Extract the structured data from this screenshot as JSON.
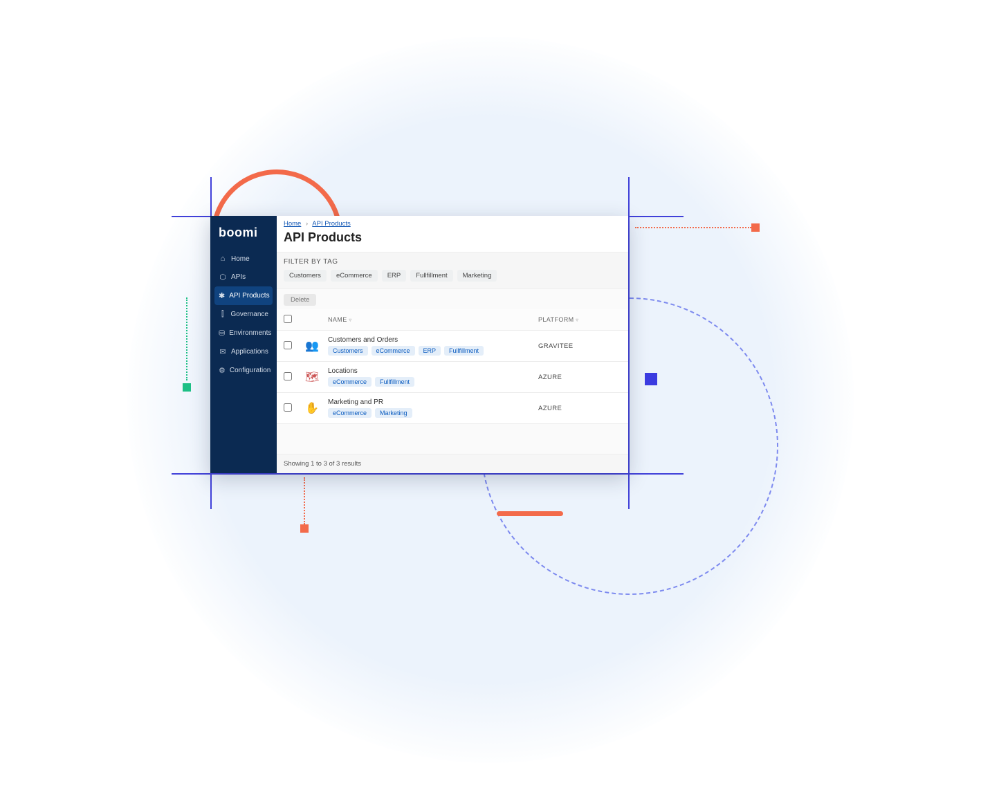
{
  "brand": "boomi",
  "sidebar": {
    "items": [
      {
        "icon": "⌂",
        "label": "Home"
      },
      {
        "icon": "⬡",
        "label": "APIs"
      },
      {
        "icon": "✱",
        "label": "API Products",
        "active": true
      },
      {
        "icon": "⫿",
        "label": "Governance"
      },
      {
        "icon": "⛁",
        "label": "Environments"
      },
      {
        "icon": "✉",
        "label": "Applications"
      },
      {
        "icon": "⚙",
        "label": "Configuration"
      }
    ]
  },
  "breadcrumbs": {
    "home": "Home",
    "current": "API Products"
  },
  "page_title": "API Products",
  "filter": {
    "label": "FILTER BY TAG",
    "tags": [
      "Customers",
      "eCommerce",
      "ERP",
      "Fullfillment",
      "Marketing"
    ]
  },
  "actions": {
    "delete_label": "Delete"
  },
  "table": {
    "columns": {
      "name": "NAME",
      "platform": "PLATFORM"
    },
    "rows": [
      {
        "name": "Customers and Orders",
        "tags": [
          "Customers",
          "eCommerce",
          "ERP",
          "Fullfillment"
        ],
        "platform": "GRAVITEE",
        "icon": "group"
      },
      {
        "name": "Locations",
        "tags": [
          "eCommerce",
          "Fullfillment"
        ],
        "platform": "AZURE",
        "icon": "map"
      },
      {
        "name": "Marketing and PR",
        "tags": [
          "eCommerce",
          "Marketing"
        ],
        "platform": "AZURE",
        "icon": "hand"
      }
    ]
  },
  "footer_text": "Showing 1 to 3 of 3 results"
}
